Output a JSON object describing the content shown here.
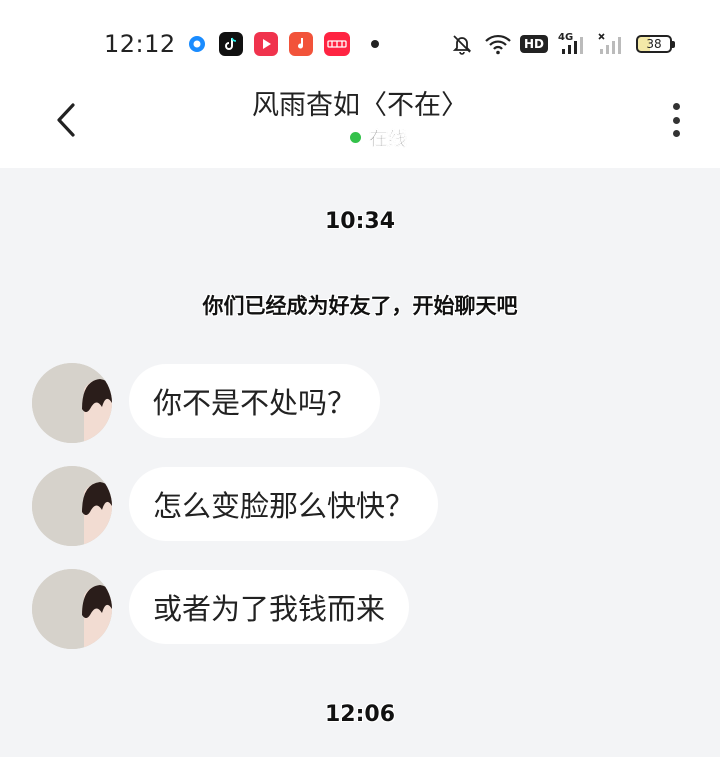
{
  "status_bar": {
    "time": "12:12",
    "battery": "38",
    "app_icons": [
      {
        "name": "browser-icon",
        "color": "#1a8cff"
      },
      {
        "name": "tiktok-icon",
        "color": "#111111"
      },
      {
        "name": "video-icon",
        "color": "#f0334d"
      },
      {
        "name": "music-icon",
        "color": "#f2533a"
      },
      {
        "name": "xiaohongshu-icon",
        "color": "#ff2442"
      }
    ],
    "signal_label": "4G",
    "hd_label": "HD"
  },
  "header": {
    "title": "风雨杳如〈不在〉",
    "status": "在线",
    "status_color": "#33c14a"
  },
  "chat": {
    "time_1": "10:34",
    "system_message": "你们已经成为好友了，开始聊天吧",
    "messages": [
      {
        "text": "你不是不处吗？"
      },
      {
        "text": "怎么变脸那么快快？"
      },
      {
        "text": "或者为了我钱而来"
      }
    ],
    "time_2": "12:06"
  }
}
